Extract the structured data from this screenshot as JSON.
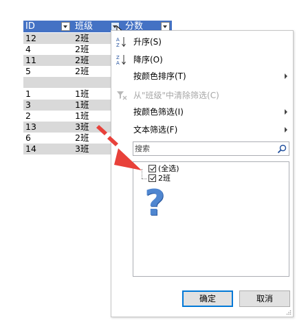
{
  "table": {
    "headers": [
      "ID",
      "班级",
      "分数"
    ],
    "rows": [
      {
        "id": "12",
        "cls": "2班",
        "shade": true
      },
      {
        "id": "4",
        "cls": "2班",
        "shade": false
      },
      {
        "id": "11",
        "cls": "2班",
        "shade": true
      },
      {
        "id": "5",
        "cls": "2班",
        "shade": false
      },
      {
        "id": "",
        "cls": "",
        "shade": true
      },
      {
        "id": "1",
        "cls": "1班",
        "shade": false
      },
      {
        "id": "3",
        "cls": "1班",
        "shade": true
      },
      {
        "id": "2",
        "cls": "1班",
        "shade": false
      },
      {
        "id": "13",
        "cls": "3班",
        "shade": true
      },
      {
        "id": "6",
        "cls": "2班",
        "shade": false
      },
      {
        "id": "14",
        "cls": "3班",
        "shade": true
      }
    ]
  },
  "menu": {
    "sort_asc": "升序(S)",
    "sort_desc": "降序(O)",
    "sort_by_color": "按颜色排序(T)",
    "clear_filter": "从\"班级\"中清除筛选(C)",
    "filter_by_color": "按颜色筛选(I)",
    "text_filters": "文本筛选(F)"
  },
  "search": {
    "placeholder": "搜索"
  },
  "list": {
    "select_all": "(全选)",
    "item_1": "2班"
  },
  "buttons": {
    "ok": "确定",
    "cancel": "取消"
  },
  "overlay": {
    "question_mark": "?"
  },
  "colors": {
    "header_bg": "#4472c4",
    "row_shade": "#d9d9d9",
    "arrow_red": "#e8413a",
    "question_blue": "#4f86d0"
  }
}
